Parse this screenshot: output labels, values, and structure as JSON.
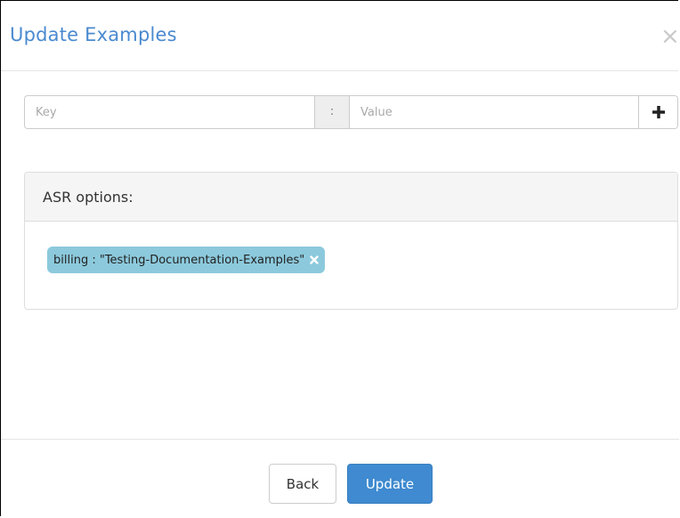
{
  "modal": {
    "title": "Update Examples",
    "close_glyph": "×"
  },
  "kv_form": {
    "key_placeholder": "Key",
    "separator": ":",
    "value_placeholder": "Value",
    "add_icon": "plus-icon"
  },
  "panel": {
    "heading": "ASR options:",
    "tags": [
      {
        "label": "billing : \"Testing-Documentation-Examples\"",
        "remove_icon": "close-icon"
      }
    ]
  },
  "footer": {
    "back_label": "Back",
    "update_label": "Update"
  },
  "colors": {
    "title": "#4a8ad0",
    "tag_bg": "#8cc9dc",
    "primary_button": "#3f8ad0"
  }
}
